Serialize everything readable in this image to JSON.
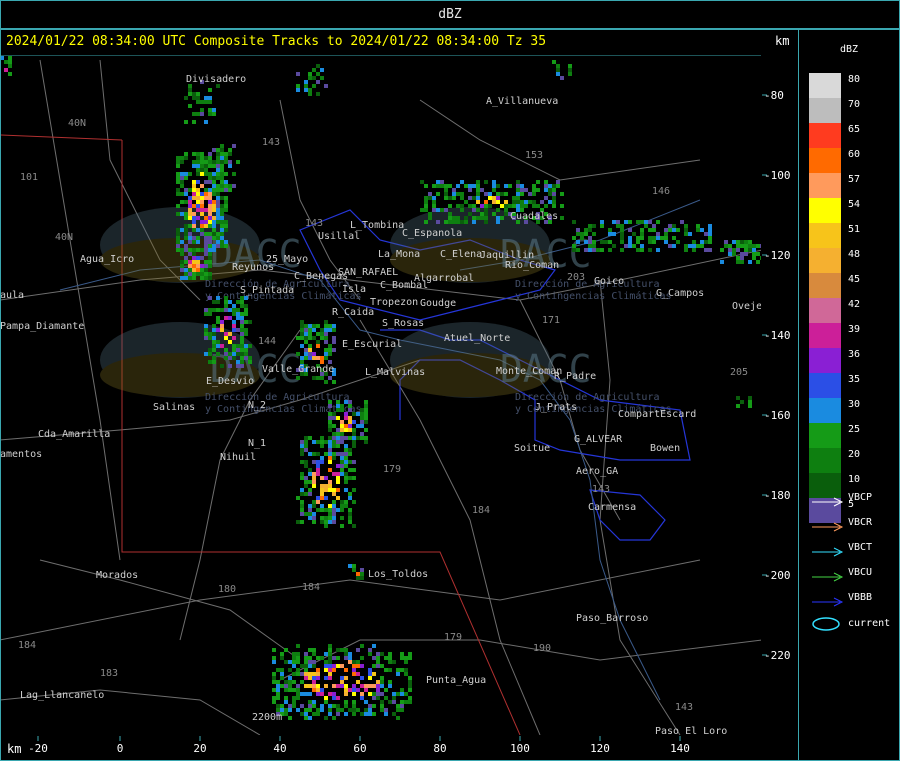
{
  "window": {
    "title": "dBZ"
  },
  "header": {
    "title": "2024/01/22 08:34:00 UTC Composite Tracks to 2024/01/22 08:34:00 Tz 35",
    "km_top": "km",
    "km_bottom": "km"
  },
  "axes": {
    "x_ticks": [
      "-20",
      "0",
      "20",
      "40",
      "60",
      "80",
      "100",
      "120",
      "140"
    ],
    "y_ticks": [
      "-80",
      "-100",
      "-120",
      "-140",
      "-160",
      "-180",
      "-200",
      "-220"
    ]
  },
  "places": [
    "Divisadero",
    "A_Villanueva",
    "Agua_Icro",
    "Pampa_Diamante",
    "aula",
    "Reyunos",
    "25_Mayo",
    "S_Pintada",
    "Usillal",
    "L_Tombina",
    "C_Espanola",
    "La_Mona",
    "C_Elena",
    "Jaquillin",
    "Rio_Coman",
    "Cuadales",
    "C_Benegas",
    "SAN_RAFAEL",
    "C_Bombal",
    "Algarrobal",
    "Isla",
    "Tropezon",
    "Goudge",
    "R_Caida",
    "S_Rosas",
    "Goico",
    "G_Campos",
    "Ovejeros",
    "E_Escurial",
    "Atuel_Norte",
    "L_Malvinas",
    "Monte_Coman",
    "E_Desvio",
    "Valle_Grande",
    "R_Padre",
    "Salinas",
    "N_2",
    "J_Prats",
    "CompartEscard",
    "N_1",
    "G_ALVEAR",
    "Cda_Amarilla",
    "amentos",
    "Nihuil",
    "Soitue",
    "Bowen",
    "Aero_GA",
    "Carmensa",
    "Morados",
    "Los_Toldos",
    "Paso_Barroso",
    "Lag_Llancanelo",
    "Punta_Agua",
    "Paso_El_Loro",
    "2200m"
  ],
  "routes": [
    "101",
    "143",
    "40N",
    "40N",
    "143",
    "153",
    "146",
    "203",
    "171",
    "144",
    "179",
    "184",
    "205",
    "180",
    "184",
    "190",
    "179",
    "183",
    "184",
    "143",
    "143"
  ],
  "legend": {
    "unit": "dBZ",
    "scale": [
      {
        "value": "80",
        "color": "#d9d9d9"
      },
      {
        "value": "70",
        "color": "#bdbdbd"
      },
      {
        "value": "65",
        "color": "#ff3b1f"
      },
      {
        "value": "60",
        "color": "#ff6a00"
      },
      {
        "value": "57",
        "color": "#ff9a5c"
      },
      {
        "value": "54",
        "color": "#ffff00"
      },
      {
        "value": "51",
        "color": "#f7c41a"
      },
      {
        "value": "48",
        "color": "#f5b030"
      },
      {
        "value": "45",
        "color": "#d88a3d"
      },
      {
        "value": "42",
        "color": "#d06898"
      },
      {
        "value": "39",
        "color": "#cc1f99"
      },
      {
        "value": "36",
        "color": "#8a1fd4"
      },
      {
        "value": "35",
        "color": "#2b4fe6"
      },
      {
        "value": "30",
        "color": "#1a8be0"
      },
      {
        "value": "25",
        "color": "#159b17"
      },
      {
        "value": "20",
        "color": "#0e7f10"
      },
      {
        "value": "10",
        "color": "#0a5e0c"
      },
      {
        "value": "5",
        "color": "#5a4a9e"
      }
    ],
    "tracks": [
      {
        "label": "VBCP",
        "color": "#ffffff"
      },
      {
        "label": "VBCR",
        "color": "#ff9a5c"
      },
      {
        "label": "VBCT",
        "color": "#33e0ff"
      },
      {
        "label": "VBCU",
        "color": "#44d444"
      },
      {
        "label": "VBBB",
        "color": "#2a36ff"
      }
    ],
    "current": {
      "label": "current",
      "color": "#33e0ff"
    }
  },
  "watermark": {
    "brand": "DACC",
    "line1": "Dirección de Agricultura",
    "line2": "y Contingencias Climáticas"
  }
}
